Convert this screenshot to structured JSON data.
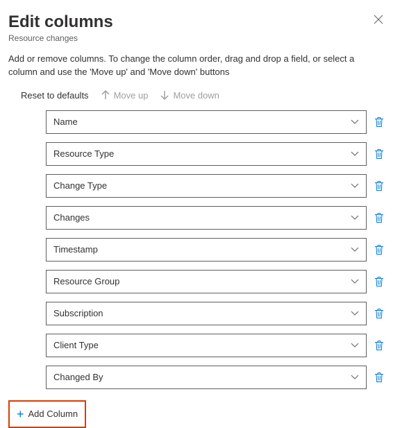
{
  "header": {
    "title": "Edit columns",
    "subtitle": "Resource changes"
  },
  "description": "Add or remove columns. To change the column order, drag and drop a field, or select a column and use the 'Move up' and 'Move down' buttons",
  "toolbar": {
    "reset": "Reset to defaults",
    "move_up": "Move up",
    "move_down": "Move down"
  },
  "columns": [
    {
      "label": "Name"
    },
    {
      "label": "Resource Type"
    },
    {
      "label": "Change Type"
    },
    {
      "label": "Changes"
    },
    {
      "label": "Timestamp"
    },
    {
      "label": "Resource Group"
    },
    {
      "label": "Subscription"
    },
    {
      "label": "Client Type"
    },
    {
      "label": "Changed By"
    }
  ],
  "add_column_label": "Add Column",
  "colors": {
    "accent": "#0078d4",
    "highlight": "#d83b01"
  }
}
